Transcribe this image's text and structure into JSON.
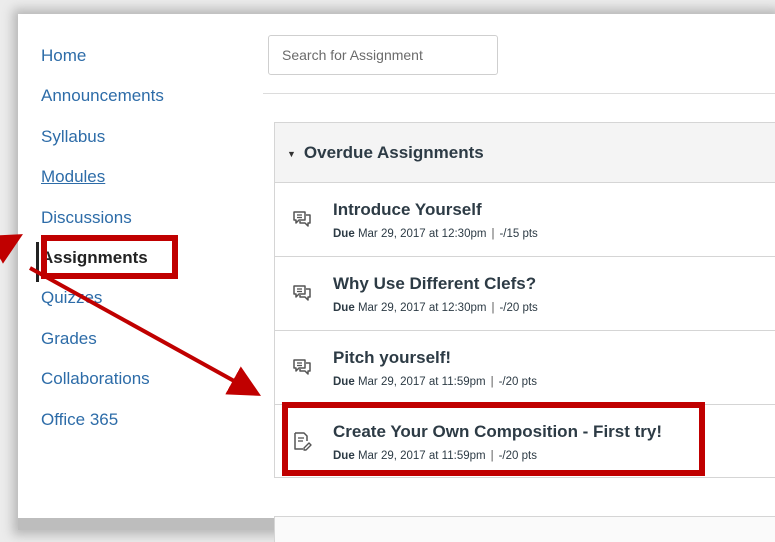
{
  "nav": {
    "items": [
      {
        "label": "Home"
      },
      {
        "label": "Announcements"
      },
      {
        "label": "Syllabus"
      },
      {
        "label": "Modules"
      },
      {
        "label": "Discussions"
      },
      {
        "label": "Assignments"
      },
      {
        "label": "Quizzes"
      },
      {
        "label": "Grades"
      },
      {
        "label": "Collaborations"
      },
      {
        "label": "Office 365"
      }
    ],
    "active": "Assignments"
  },
  "search": {
    "placeholder": "Search for Assignment"
  },
  "group": {
    "title": "Overdue Assignments",
    "assignments": [
      {
        "title": "Introduce Yourself",
        "due_label": "Due",
        "due": "Mar 29, 2017 at 12:30pm",
        "points": "-/15 pts",
        "icon": "discussion-icon"
      },
      {
        "title": "Why Use Different Clefs?",
        "due_label": "Due",
        "due": "Mar 29, 2017 at 12:30pm",
        "points": "-/20 pts",
        "icon": "discussion-icon"
      },
      {
        "title": "Pitch yourself!",
        "due_label": "Due",
        "due": "Mar 29, 2017 at 11:59pm",
        "points": "-/20 pts",
        "icon": "discussion-icon"
      },
      {
        "title": "Create Your Own Composition - First try!",
        "due_label": "Due",
        "due": "Mar 29, 2017 at 11:59pm",
        "points": "-/20 pts",
        "icon": "assignment-icon"
      }
    ]
  },
  "colors": {
    "link": "#2d6ca8",
    "text": "#2d3b45",
    "annotation": "#c00000"
  }
}
